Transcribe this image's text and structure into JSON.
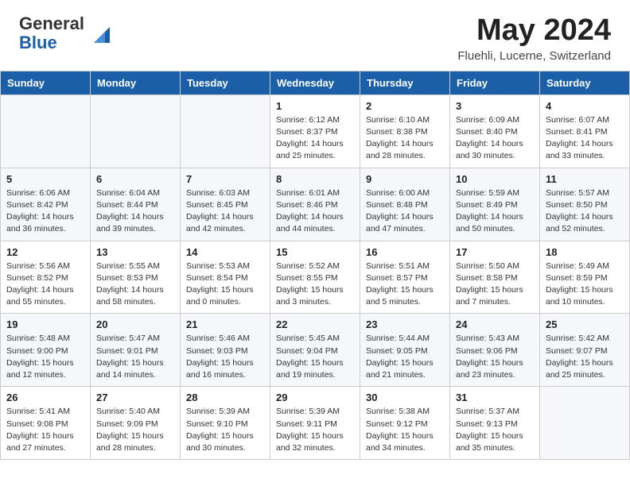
{
  "header": {
    "logo_line1": "General",
    "logo_line2": "Blue",
    "month": "May 2024",
    "location": "Fluehli, Lucerne, Switzerland"
  },
  "weekdays": [
    "Sunday",
    "Monday",
    "Tuesday",
    "Wednesday",
    "Thursday",
    "Friday",
    "Saturday"
  ],
  "weeks": [
    [
      {
        "day": "",
        "info": ""
      },
      {
        "day": "",
        "info": ""
      },
      {
        "day": "",
        "info": ""
      },
      {
        "day": "1",
        "info": "Sunrise: 6:12 AM\nSunset: 8:37 PM\nDaylight: 14 hours\nand 25 minutes."
      },
      {
        "day": "2",
        "info": "Sunrise: 6:10 AM\nSunset: 8:38 PM\nDaylight: 14 hours\nand 28 minutes."
      },
      {
        "day": "3",
        "info": "Sunrise: 6:09 AM\nSunset: 8:40 PM\nDaylight: 14 hours\nand 30 minutes."
      },
      {
        "day": "4",
        "info": "Sunrise: 6:07 AM\nSunset: 8:41 PM\nDaylight: 14 hours\nand 33 minutes."
      }
    ],
    [
      {
        "day": "5",
        "info": "Sunrise: 6:06 AM\nSunset: 8:42 PM\nDaylight: 14 hours\nand 36 minutes."
      },
      {
        "day": "6",
        "info": "Sunrise: 6:04 AM\nSunset: 8:44 PM\nDaylight: 14 hours\nand 39 minutes."
      },
      {
        "day": "7",
        "info": "Sunrise: 6:03 AM\nSunset: 8:45 PM\nDaylight: 14 hours\nand 42 minutes."
      },
      {
        "day": "8",
        "info": "Sunrise: 6:01 AM\nSunset: 8:46 PM\nDaylight: 14 hours\nand 44 minutes."
      },
      {
        "day": "9",
        "info": "Sunrise: 6:00 AM\nSunset: 8:48 PM\nDaylight: 14 hours\nand 47 minutes."
      },
      {
        "day": "10",
        "info": "Sunrise: 5:59 AM\nSunset: 8:49 PM\nDaylight: 14 hours\nand 50 minutes."
      },
      {
        "day": "11",
        "info": "Sunrise: 5:57 AM\nSunset: 8:50 PM\nDaylight: 14 hours\nand 52 minutes."
      }
    ],
    [
      {
        "day": "12",
        "info": "Sunrise: 5:56 AM\nSunset: 8:52 PM\nDaylight: 14 hours\nand 55 minutes."
      },
      {
        "day": "13",
        "info": "Sunrise: 5:55 AM\nSunset: 8:53 PM\nDaylight: 14 hours\nand 58 minutes."
      },
      {
        "day": "14",
        "info": "Sunrise: 5:53 AM\nSunset: 8:54 PM\nDaylight: 15 hours\nand 0 minutes."
      },
      {
        "day": "15",
        "info": "Sunrise: 5:52 AM\nSunset: 8:55 PM\nDaylight: 15 hours\nand 3 minutes."
      },
      {
        "day": "16",
        "info": "Sunrise: 5:51 AM\nSunset: 8:57 PM\nDaylight: 15 hours\nand 5 minutes."
      },
      {
        "day": "17",
        "info": "Sunrise: 5:50 AM\nSunset: 8:58 PM\nDaylight: 15 hours\nand 7 minutes."
      },
      {
        "day": "18",
        "info": "Sunrise: 5:49 AM\nSunset: 8:59 PM\nDaylight: 15 hours\nand 10 minutes."
      }
    ],
    [
      {
        "day": "19",
        "info": "Sunrise: 5:48 AM\nSunset: 9:00 PM\nDaylight: 15 hours\nand 12 minutes."
      },
      {
        "day": "20",
        "info": "Sunrise: 5:47 AM\nSunset: 9:01 PM\nDaylight: 15 hours\nand 14 minutes."
      },
      {
        "day": "21",
        "info": "Sunrise: 5:46 AM\nSunset: 9:03 PM\nDaylight: 15 hours\nand 16 minutes."
      },
      {
        "day": "22",
        "info": "Sunrise: 5:45 AM\nSunset: 9:04 PM\nDaylight: 15 hours\nand 19 minutes."
      },
      {
        "day": "23",
        "info": "Sunrise: 5:44 AM\nSunset: 9:05 PM\nDaylight: 15 hours\nand 21 minutes."
      },
      {
        "day": "24",
        "info": "Sunrise: 5:43 AM\nSunset: 9:06 PM\nDaylight: 15 hours\nand 23 minutes."
      },
      {
        "day": "25",
        "info": "Sunrise: 5:42 AM\nSunset: 9:07 PM\nDaylight: 15 hours\nand 25 minutes."
      }
    ],
    [
      {
        "day": "26",
        "info": "Sunrise: 5:41 AM\nSunset: 9:08 PM\nDaylight: 15 hours\nand 27 minutes."
      },
      {
        "day": "27",
        "info": "Sunrise: 5:40 AM\nSunset: 9:09 PM\nDaylight: 15 hours\nand 28 minutes."
      },
      {
        "day": "28",
        "info": "Sunrise: 5:39 AM\nSunset: 9:10 PM\nDaylight: 15 hours\nand 30 minutes."
      },
      {
        "day": "29",
        "info": "Sunrise: 5:39 AM\nSunset: 9:11 PM\nDaylight: 15 hours\nand 32 minutes."
      },
      {
        "day": "30",
        "info": "Sunrise: 5:38 AM\nSunset: 9:12 PM\nDaylight: 15 hours\nand 34 minutes."
      },
      {
        "day": "31",
        "info": "Sunrise: 5:37 AM\nSunset: 9:13 PM\nDaylight: 15 hours\nand 35 minutes."
      },
      {
        "day": "",
        "info": ""
      }
    ]
  ]
}
